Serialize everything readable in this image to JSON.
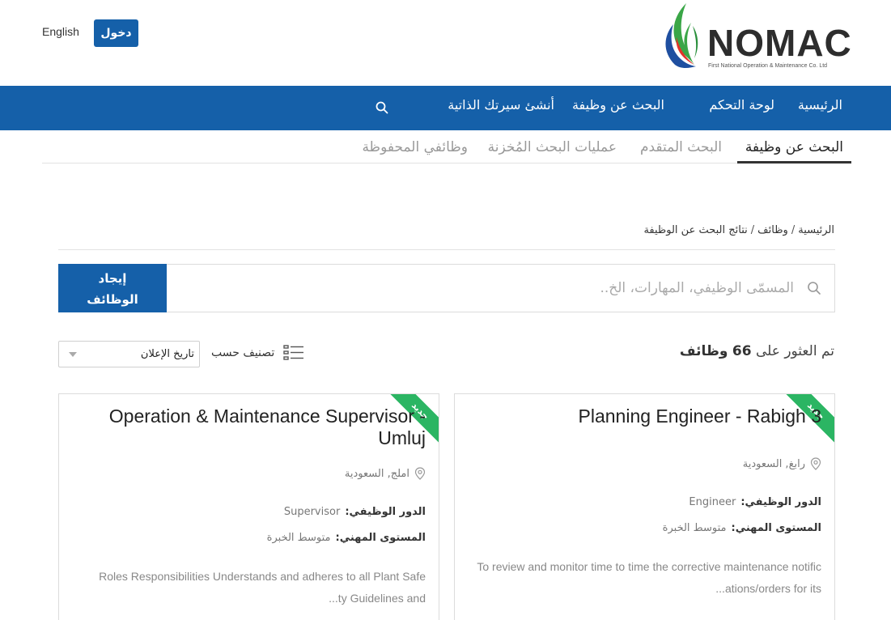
{
  "header": {
    "language_label": "English",
    "login_label": "دخول",
    "logo_text": "NOMAC",
    "logo_subtitle": "First National Operation & Maintenance Co. Ltd"
  },
  "main_nav": {
    "items": [
      {
        "label": "الرئيسية"
      },
      {
        "label": "لوحة التحكم"
      },
      {
        "label": "البحث عن وظيفة"
      },
      {
        "label": "أنشئ سيرتك الذاتية"
      }
    ],
    "search_icon": "search-icon"
  },
  "sub_tabs": [
    {
      "label": "البحث عن وظيفة",
      "active": true
    },
    {
      "label": "البحث المتقدم",
      "active": false
    },
    {
      "label": "عمليات البحث المُخزنة",
      "active": false
    },
    {
      "label": "وظائفي المحفوظة",
      "active": false
    }
  ],
  "breadcrumb": [
    "الرئيسية",
    "وظائف",
    "نتائج البحث عن الوظيفة"
  ],
  "search": {
    "placeholder": "المسمّى الوظيفي، المهارات، الخ..",
    "button_line1": "إيجاد",
    "button_line2": "الوظائف"
  },
  "results": {
    "prefix": "تم العثور على",
    "count": "66",
    "suffix": "وظائف"
  },
  "sort": {
    "label": "تصنيف حسب",
    "selected": "تاريخ الإعلان"
  },
  "jobs": [
    {
      "badge": "جديد",
      "title_line1": "Planning Engineer - Rabigh 3",
      "title_line2": "",
      "location": "رابغ, السعودية",
      "role_label": "الدور الوظيفي:",
      "role_value": "Engineer",
      "level_label": "المستوى المهني:",
      "level_value": "متوسط الخبرة",
      "desc_line1": "To review and monitor time to time the corrective maintenance notific",
      "desc_line2": "...ations/orders for its"
    },
    {
      "badge": "جديد",
      "title_line1": "Operation & Maintenance Supervisor -",
      "title_line2": "Umluj",
      "location": "املج, السعودية",
      "role_label": "الدور الوظيفي:",
      "role_value": "Supervisor",
      "level_label": "المستوى المهني:",
      "level_value": "متوسط الخبرة",
      "desc_line1": "Roles     Responsibilities    Understands and adheres to all Plant Safe",
      "desc_line2": "...ty Guidelines and"
    }
  ],
  "colors": {
    "primary": "#1560a9",
    "badge": "#2bb563",
    "logo_green": "#3aa647",
    "logo_blue": "#1f4fa0",
    "logo_red": "#e2332a"
  }
}
